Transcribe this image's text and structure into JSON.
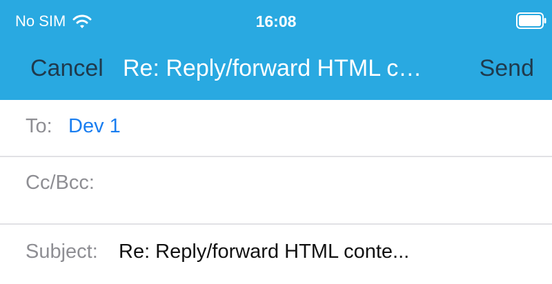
{
  "status_bar": {
    "carrier": "No SIM",
    "time": "16:08",
    "wifi_icon": "wifi-icon",
    "battery_icon": "battery-icon"
  },
  "nav": {
    "cancel_label": "Cancel",
    "title": "Re: Reply/forward HTML c…",
    "send_label": "Send"
  },
  "fields": {
    "to_label": "To:",
    "to_value": "Dev 1",
    "cc_label": "Cc/Bcc:",
    "cc_value": "",
    "subject_label": "Subject:",
    "subject_value": "Re: Reply/forward HTML conte..."
  },
  "colors": {
    "header_bg": "#29a9e1",
    "nav_button": "#1f3a4d",
    "recipient": "#1a7ef0",
    "label": "#8e8e93"
  }
}
